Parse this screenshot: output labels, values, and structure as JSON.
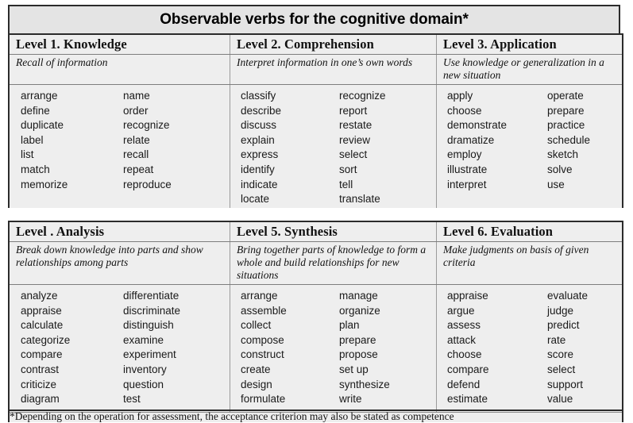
{
  "document": {
    "title": "Observable verbs for the cognitive domain*",
    "footnote": "*Depending on the operation for assessment, the acceptance criterion may also be stated as competence"
  },
  "colors": {
    "page_background": "#ffffff",
    "table_background": "#eeeeee",
    "title_background": "#e4e4e4",
    "border_dark": "#2b2b2b",
    "border_light": "#9a9a9a",
    "text": "#111111"
  },
  "sections": [
    {
      "name": "section-upper",
      "levels": [
        {
          "title": "Level 1. Knowledge",
          "description": "Recall of information",
          "verbs_left": [
            "arrange",
            "define",
            "duplicate",
            "label",
            "list",
            "match",
            "memorize"
          ],
          "verbs_right": [
            "name",
            "order",
            "recognize",
            "relate",
            "recall",
            "repeat",
            "reproduce"
          ]
        },
        {
          "title": "Level 2. Comprehension",
          "description": "Interpret information in one’s own words",
          "verbs_left": [
            "classify",
            "describe",
            "discuss",
            "explain",
            "express",
            "identify",
            "indicate",
            "locate"
          ],
          "verbs_right": [
            "recognize",
            "report",
            "restate",
            "review",
            "select",
            "sort",
            "tell",
            "translate"
          ]
        },
        {
          "title": "Level 3. Application",
          "description": "Use knowledge or generalization in a new situation",
          "verbs_left": [
            "apply",
            "choose",
            "demonstrate",
            "dramatize",
            "employ",
            "illustrate",
            "interpret"
          ],
          "verbs_right": [
            "operate",
            "prepare",
            "practice",
            "schedule",
            "sketch",
            "solve",
            "use"
          ]
        }
      ]
    },
    {
      "name": "section-lower",
      "levels": [
        {
          "title": "Level . Analysis",
          "description": "Break down knowledge into parts and show relationships among parts",
          "verbs_left": [
            "analyze",
            "appraise",
            "calculate",
            "categorize",
            "compare",
            "contrast",
            "criticize",
            "diagram"
          ],
          "verbs_right": [
            "differentiate",
            "discriminate",
            "distinguish",
            "examine",
            "experiment",
            "inventory",
            "question",
            "test"
          ]
        },
        {
          "title": "Level 5. Synthesis",
          "description": "Bring together parts of knowledge to form a whole and build relationships for new situations",
          "verbs_left": [
            "arrange",
            "assemble",
            "collect",
            "compose",
            "construct",
            "create",
            "design",
            "formulate"
          ],
          "verbs_right": [
            "manage",
            "organize",
            "plan",
            "prepare",
            "propose",
            "set up",
            "synthesize",
            "write"
          ]
        },
        {
          "title": "Level 6. Evaluation",
          "description": "Make judgments on basis of given criteria",
          "verbs_left": [
            "appraise",
            "argue",
            "assess",
            "attack",
            "choose",
            "compare",
            "defend",
            "estimate"
          ],
          "verbs_right": [
            "evaluate",
            "judge",
            "predict",
            "rate",
            "score",
            "select",
            "support",
            "value"
          ]
        }
      ]
    }
  ]
}
